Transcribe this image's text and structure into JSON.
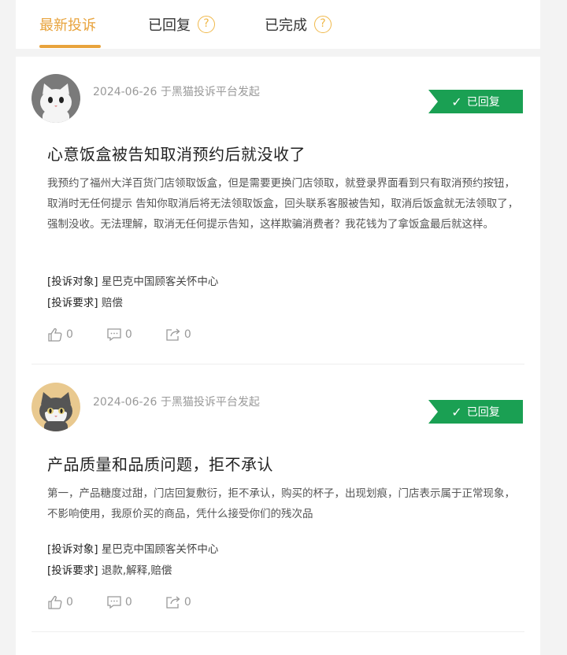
{
  "tabs": [
    {
      "label": "最新投诉"
    },
    {
      "label": "已回复",
      "help": "?"
    },
    {
      "label": "已完成",
      "help": "?"
    }
  ],
  "complaints": [
    {
      "date": "2024-06-26",
      "source": "于黑猫投诉平台发起",
      "status": "已回复",
      "title": "心意饭盒被告知取消预约后就没收了",
      "desc": "我预约了福州大洋百货门店领取饭盒，但是需要更换门店领取，就登录界面看到只有取消预约按钮，取消时无任何提示 告知你取消后将无法领取饭盒，回头联系客服被告知，取消后饭盒就无法领取了，强制没收。无法理解，取消无任何提示告知，这样欺骗消费者？我花钱为了拿饭盒最后就这样。",
      "target_label": "[投诉对象]",
      "target": "星巴克中国顾客关怀中心",
      "request_label": "[投诉要求]",
      "request": "赔偿",
      "likes": "0",
      "comments": "0",
      "shares": "0"
    },
    {
      "date": "2024-06-26",
      "source": "于黑猫投诉平台发起",
      "status": "已回复",
      "title": "产品质量和品质问题，拒不承认",
      "desc": "第一，产品糖度过甜，门店回复敷衍，拒不承认，购买的杯子，出现划痕，门店表示属于正常现象，不影响使用，我原价买的商品，凭什么接受你们的残次品",
      "target_label": "[投诉对象]",
      "target": "星巴克中国顾客关怀中心",
      "request_label": "[投诉要求]",
      "request": "退款,解释,赔偿",
      "likes": "0",
      "comments": "0",
      "shares": "0"
    }
  ],
  "colors": {
    "accent": "#e8a33c",
    "status": "#1aa053"
  }
}
